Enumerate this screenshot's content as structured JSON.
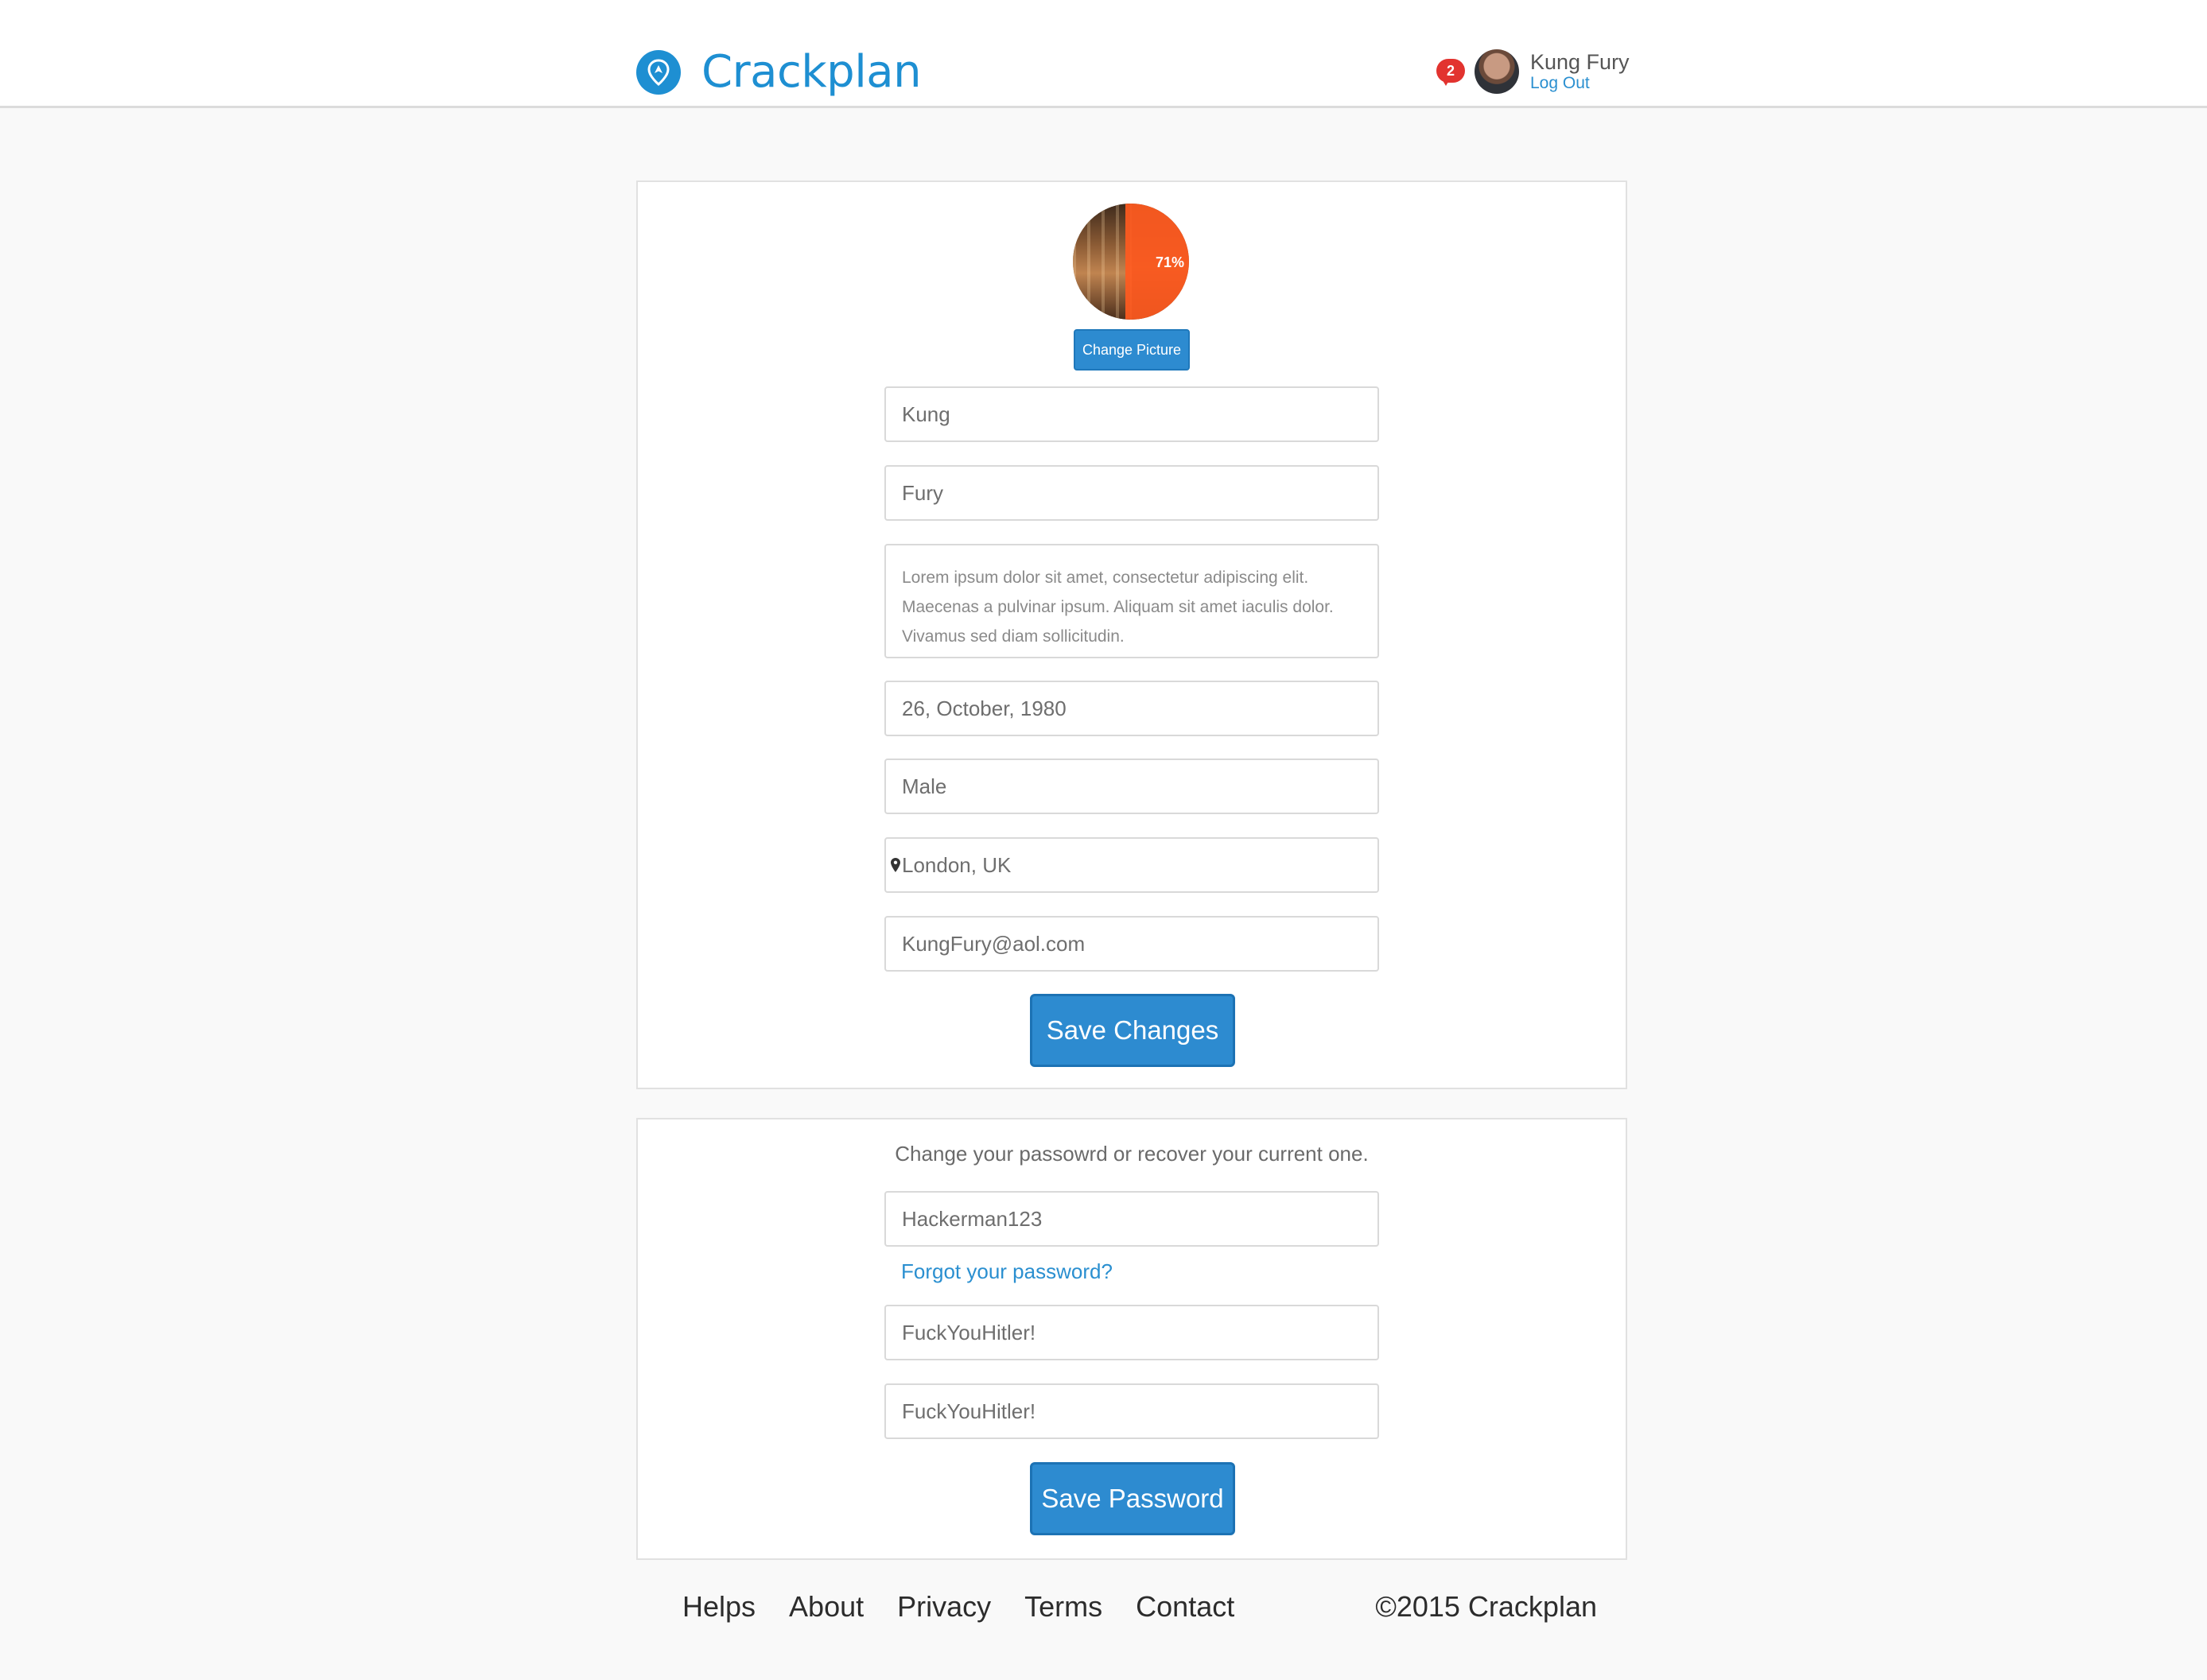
{
  "app": {
    "name": "Crackplan"
  },
  "user": {
    "name": "Kung Fury",
    "logout_label": "Log Out",
    "notifications": "2"
  },
  "profile": {
    "picture_progress": "71%",
    "change_picture_label": "Change Picture",
    "first_name": "Kung",
    "last_name": "Fury",
    "bio": "Lorem ipsum dolor sit amet, consectetur adipiscing elit. Maecenas a pulvinar ipsum. Aliquam sit amet iaculis dolor. Vivamus sed diam sollicitudin.",
    "birthday": "26, October, 1980",
    "gender": "Male",
    "location": "London, UK",
    "email": "KungFury@aol.com",
    "save_label": "Save Changes"
  },
  "password": {
    "note": "Change your passowrd or recover your current one.",
    "current": "Hackerman123",
    "forgot_label": "Forgot your password?",
    "new": "FuckYouHitler!",
    "confirm": "FuckYouHitler!",
    "save_label": "Save Password"
  },
  "footer": {
    "links": [
      "Helps",
      "About",
      "Privacy",
      "Terms",
      "Contact"
    ],
    "copyright": "©2015 Crackplan"
  },
  "colors": {
    "brand": "#1e8fd2",
    "button": "#2d8bd0",
    "badge": "#e2332f",
    "progress": "#ff5a1f"
  }
}
